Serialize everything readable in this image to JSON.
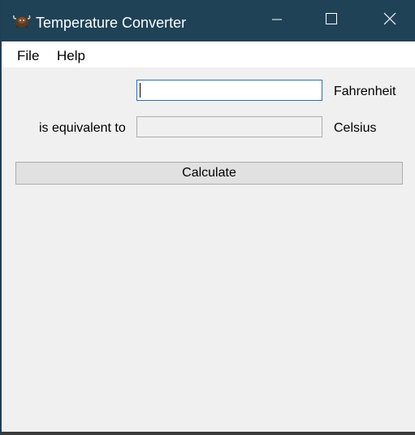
{
  "window": {
    "title": "Temperature Converter",
    "title_bar_color": "#1f4257",
    "app_icon": "yak-icon",
    "controls": {
      "minimize": "minimize-icon",
      "maximize": "maximize-icon",
      "close": "close-icon"
    }
  },
  "menu": {
    "items": [
      {
        "label": "File"
      },
      {
        "label": "Help"
      }
    ]
  },
  "form": {
    "fahrenheit": {
      "value": "",
      "unit_label": "Fahrenheit"
    },
    "equivalent_label": "is equivalent to",
    "celsius": {
      "value": "",
      "unit_label": "Celsius"
    },
    "calculate_label": "Calculate"
  }
}
